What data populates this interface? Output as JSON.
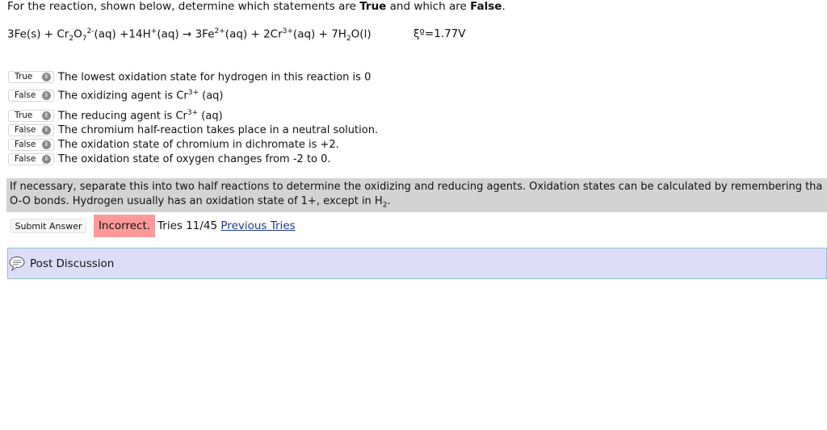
{
  "intro": {
    "pre": "For the reaction, shown below, determine which statements are ",
    "true_word": "True",
    "mid": " and which are ",
    "false_word": "False",
    "end": "."
  },
  "equation": {
    "p1": "3Fe(s) + Cr",
    "s1": "2",
    "p2": "O",
    "s2": "7",
    "sup1": "2-",
    "p3": "(aq) +14H",
    "sup2": "+",
    "p4": "(aq) → 3Fe",
    "sup3": "2+",
    "p5": "(aq) + 2Cr",
    "sup4": "3+",
    "p6": "(aq) + 7H",
    "s3": "2",
    "p7": "O(l)",
    "e0": "ξº=1.77V"
  },
  "statements": [
    {
      "selected": "True",
      "text": "The lowest oxidation state for hydrogen in this reaction is 0",
      "sup": "",
      "after": ""
    },
    {
      "selected": "False",
      "text": "The oxidizing agent is Cr",
      "sup": "3+",
      "after": " (aq)"
    },
    {
      "selected": "True",
      "text": "The reducing agent is Cr",
      "sup": "3+",
      "after": " (aq)"
    },
    {
      "selected": "False",
      "text": "The chromium half-reaction takes place in a neutral solution.",
      "sup": "",
      "after": ""
    },
    {
      "selected": "False",
      "text": "The oxidation state of chromium in dichromate is +2.",
      "sup": "",
      "after": ""
    },
    {
      "selected": "False",
      "text": "The oxidation state of oxygen changes from -2 to 0.",
      "sup": "",
      "after": ""
    }
  ],
  "hint": {
    "line1": "If necessary, separate this into two half reactions to determine the oxidizing and reducing agents. Oxidation states can be calculated by remembering tha",
    "line2_pre": "O-O bonds. Hydrogen usually has an oxidation state of 1+, except in H",
    "line2_sub": "2",
    "line2_post": "."
  },
  "submit_label": "Submit Answer",
  "result_label": "Incorrect.",
  "tries_text": "Tries 11/45",
  "previous_tries_label": "Previous Tries",
  "discussion_label": "Post Discussion",
  "colors": {
    "incorrect_bg": "#ff9999",
    "discussion_bg": "#ddddfa",
    "hint_bg": "#d3d3d3",
    "link": "#1a3a8c"
  }
}
